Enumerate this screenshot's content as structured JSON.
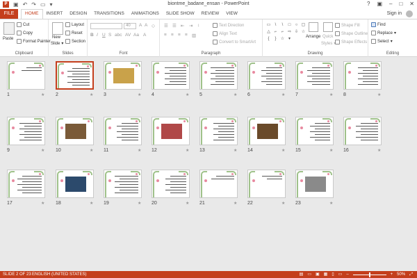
{
  "app": {
    "title": "biontme_badane_ensan - PowerPoint",
    "signin": "Sign in"
  },
  "tabs": {
    "file": "FILE",
    "items": [
      "HOME",
      "INSERT",
      "DESIGN",
      "TRANSITIONS",
      "ANIMATIONS",
      "SLIDE SHOW",
      "REVIEW",
      "VIEW"
    ],
    "active": "HOME"
  },
  "ribbon": {
    "clipboard": {
      "label": "Clipboard",
      "paste": "Paste",
      "cut": "Cut",
      "copy": "Copy",
      "format_painter": "Format Painter"
    },
    "slides": {
      "label": "Slides",
      "new_slide": "New",
      "new_slide2": "Slide",
      "layout": "Layout",
      "reset": "Reset",
      "section": "Section"
    },
    "font": {
      "label": "Font",
      "size": "40"
    },
    "paragraph": {
      "label": "Paragraph",
      "text_direction": "Text Direction",
      "align_text": "Align Text",
      "convert_smartart": "Convert to SmartArt"
    },
    "drawing": {
      "label": "Drawing",
      "arrange": "Arrange",
      "quick_styles": "Quick",
      "quick_styles2": "Styles",
      "shape_fill": "Shape Fill",
      "shape_outline": "Shape Outline",
      "shape_effects": "Shape Effects"
    },
    "editing": {
      "label": "Editing",
      "find": "Find",
      "replace": "Replace",
      "select": "Select"
    }
  },
  "slides": [
    {
      "num": "1"
    },
    {
      "num": "2"
    },
    {
      "num": "3"
    },
    {
      "num": "4"
    },
    {
      "num": "5"
    },
    {
      "num": "6"
    },
    {
      "num": "7"
    },
    {
      "num": "8"
    },
    {
      "num": "9"
    },
    {
      "num": "10"
    },
    {
      "num": "11"
    },
    {
      "num": "12"
    },
    {
      "num": "13"
    },
    {
      "num": "14"
    },
    {
      "num": "15"
    },
    {
      "num": "16"
    },
    {
      "num": "17"
    },
    {
      "num": "18"
    },
    {
      "num": "19"
    },
    {
      "num": "20"
    },
    {
      "num": "21"
    },
    {
      "num": "22"
    },
    {
      "num": "23"
    }
  ],
  "status": {
    "slide_info": "SLIDE 2 OF 23",
    "language": "ENGLISH (UNITED STATES)",
    "zoom": "50%"
  }
}
